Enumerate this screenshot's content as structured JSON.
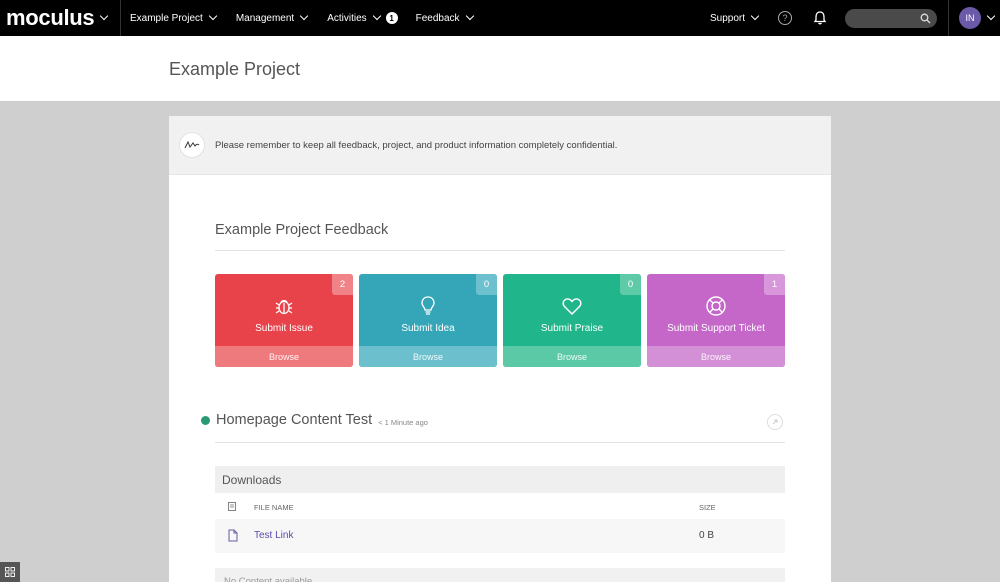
{
  "nav": {
    "brand": "moculus",
    "project_label": "Example Project",
    "management_label": "Management",
    "activities_label": "Activities",
    "activities_badge": "1",
    "feedback_label": "Feedback",
    "support_label": "Support",
    "help_symbol": "?",
    "avatar_initials": "IN"
  },
  "page": {
    "title": "Example Project"
  },
  "notice": {
    "text": "Please remember to keep all feedback, project, and product information completely confidential."
  },
  "feedback": {
    "title": "Example Project Feedback",
    "tiles": [
      {
        "label": "Submit Issue",
        "count": "2",
        "browse": "Browse",
        "icon": "bug-icon",
        "color": "#e8434a",
        "bottom_color": "#ef7a7e",
        "count_bg": "#ef8387"
      },
      {
        "label": "Submit Idea",
        "count": "0",
        "browse": "Browse",
        "icon": "lightbulb-icon",
        "color": "#35a6b8",
        "bottom_color": "#6cbfcc",
        "count_bg": "#6dc0cd"
      },
      {
        "label": "Submit Praise",
        "count": "0",
        "browse": "Browse",
        "icon": "heart-icon",
        "color": "#20b58a",
        "bottom_color": "#5bc9a6",
        "count_bg": "#5ecaa8"
      },
      {
        "label": "Submit Support Ticket",
        "count": "1",
        "browse": "Browse",
        "icon": "lifebuoy-icon",
        "color": "#c467c9",
        "bottom_color": "#d390d7",
        "count_bg": "#d797da"
      }
    ]
  },
  "content": {
    "title": "Homepage Content Test",
    "time": "< 1 Minute ago",
    "status_color": "#2a9a76",
    "downloads": {
      "heading": "Downloads",
      "columns": {
        "file_name": "FILE NAME",
        "size": "SIZE"
      },
      "rows": [
        {
          "name": "Test Link",
          "size": "0 B"
        }
      ]
    },
    "empty_text": "No Content available"
  }
}
